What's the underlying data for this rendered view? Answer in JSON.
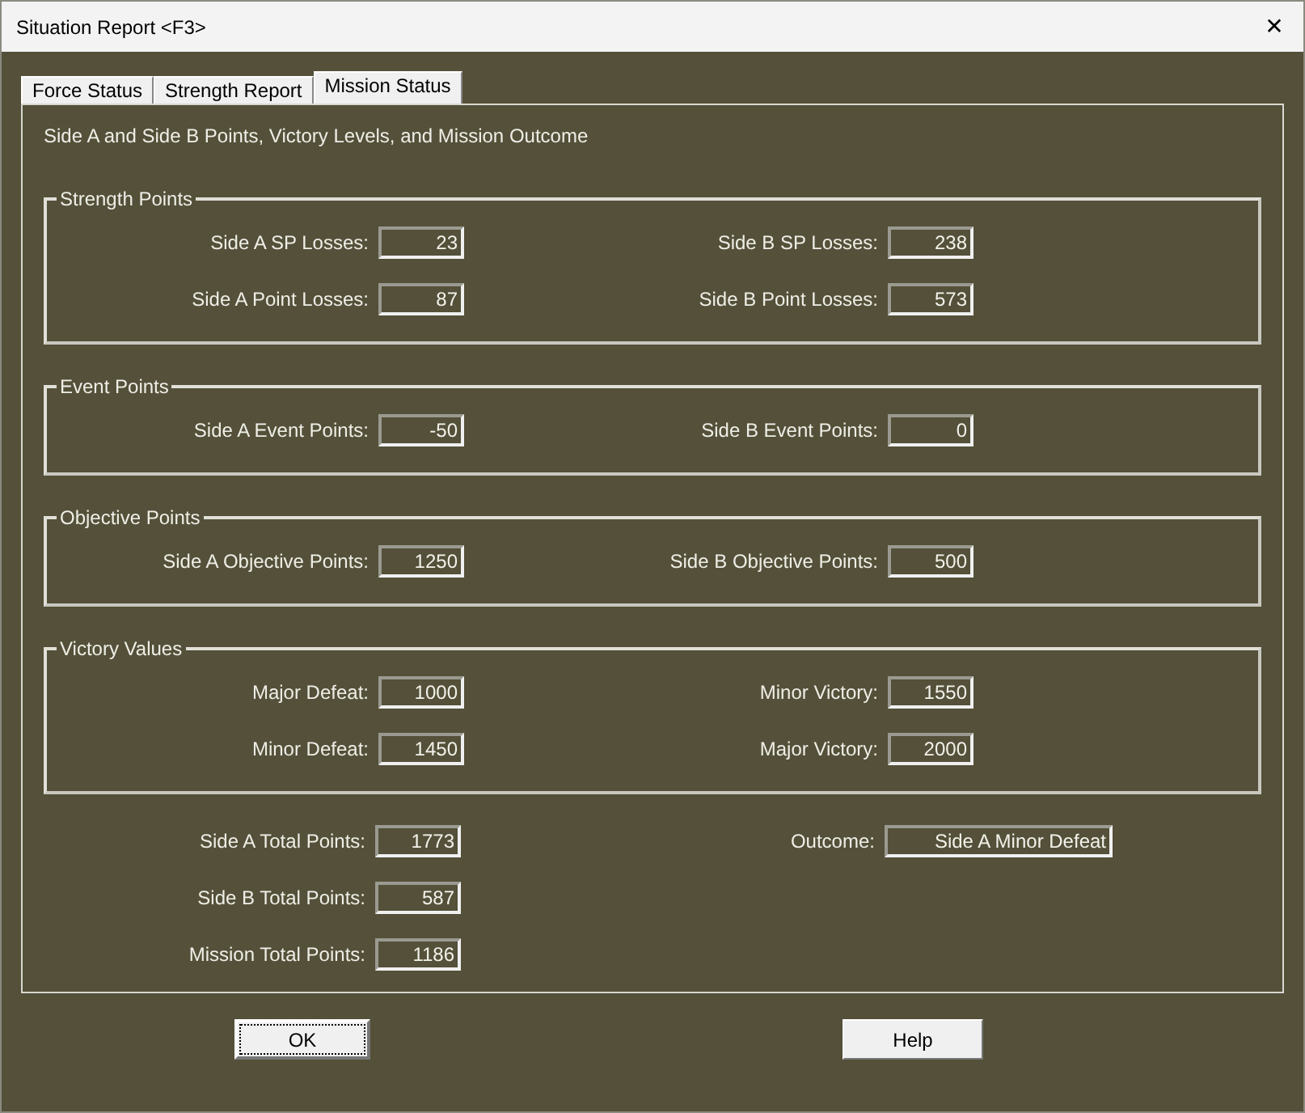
{
  "window": {
    "title": "Situation Report <F3>",
    "close": "✕"
  },
  "tabs": [
    {
      "label": "Force Status",
      "selected": false
    },
    {
      "label": "Strength Report",
      "selected": false
    },
    {
      "label": "Mission Status",
      "selected": true
    }
  ],
  "heading": "Side A and Side B Points, Victory Levels, and Mission Outcome",
  "groups": [
    {
      "title": "Strength Points",
      "rows": [
        {
          "left": {
            "label": "Side A SP Losses:",
            "value": "23"
          },
          "right": {
            "label": "Side B SP Losses:",
            "value": "238"
          }
        },
        {
          "left": {
            "label": "Side A Point Losses:",
            "value": "87"
          },
          "right": {
            "label": "Side B Point Losses:",
            "value": "573"
          }
        }
      ]
    },
    {
      "title": "Event Points",
      "rows": [
        {
          "left": {
            "label": "Side A Event Points:",
            "value": "-50"
          },
          "right": {
            "label": "Side B Event Points:",
            "value": "0"
          }
        }
      ]
    },
    {
      "title": "Objective Points",
      "rows": [
        {
          "left": {
            "label": "Side A Objective Points:",
            "value": "1250"
          },
          "right": {
            "label": "Side B Objective Points:",
            "value": "500"
          }
        }
      ]
    },
    {
      "title": "Victory Values",
      "rows": [
        {
          "left": {
            "label": "Major Defeat:",
            "value": "1000"
          },
          "right": {
            "label": "Minor Victory:",
            "value": "1550"
          }
        },
        {
          "left": {
            "label": "Minor Defeat:",
            "value": "1450"
          },
          "right": {
            "label": "Major Victory:",
            "value": "2000"
          }
        }
      ]
    }
  ],
  "totals": [
    {
      "left": {
        "label": "Side A Total Points:",
        "value": "1773"
      },
      "right": {
        "label": "Outcome:",
        "value": "Side A Minor Defeat"
      }
    },
    {
      "left": {
        "label": "Side B Total Points:",
        "value": "587"
      }
    },
    {
      "left": {
        "label": "Mission Total Points:",
        "value": "1186"
      }
    }
  ],
  "buttons": [
    {
      "label": "OK",
      "selected": true
    },
    {
      "label": "Help",
      "selected": false
    }
  ]
}
